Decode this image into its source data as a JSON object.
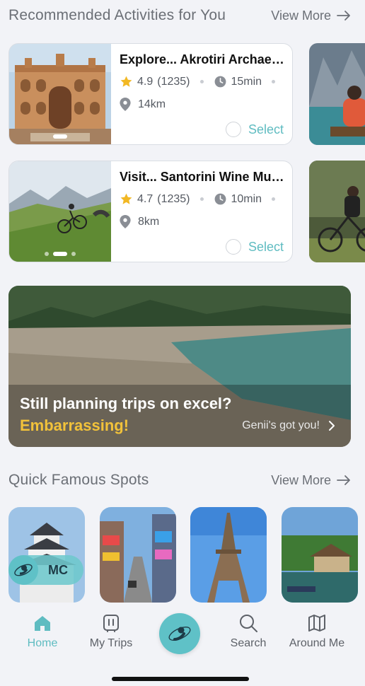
{
  "recommended": {
    "title": "Recommended Activities for You",
    "view_more": "View More",
    "cards": [
      {
        "title": "Explore... Akrotiri Archaeological Site",
        "rating": "4.9",
        "reviews": "(1235)",
        "duration": "15min",
        "distance": "14km",
        "select_label": "Select"
      },
      {
        "title": "Visit... Santorini Wine Museum",
        "rating": "4.7",
        "reviews": "(1235)",
        "duration": "10min",
        "distance": "8km",
        "select_label": "Select"
      }
    ]
  },
  "banner": {
    "line1": "Still planning trips on excel?",
    "line2": "Embarrassing!",
    "cta": "Genii's got you!"
  },
  "spots": {
    "title": "Quick Famous Spots",
    "view_more": "View More",
    "badge_text": "MC"
  },
  "tabs": [
    {
      "label": "Home",
      "icon": "home-icon",
      "active": true
    },
    {
      "label": "My Trips",
      "icon": "suitcase-icon"
    },
    {
      "label": "Search",
      "icon": "search-icon"
    },
    {
      "label": "Around Me",
      "icon": "map-icon"
    }
  ],
  "colors": {
    "accent": "#5fc1c7",
    "highlight": "#f2c23a",
    "background": "#f2f3f7"
  }
}
